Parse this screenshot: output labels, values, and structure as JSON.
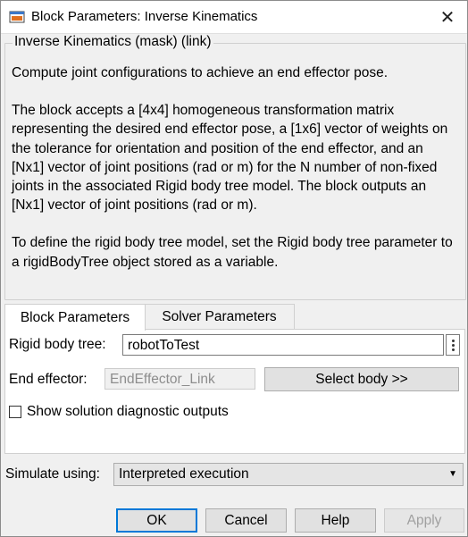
{
  "window": {
    "title": "Block Parameters: Inverse Kinematics",
    "close_icon": "close-icon",
    "app_icon": "matlab-icon"
  },
  "mask": {
    "legend": "Inverse Kinematics (mask) (link)",
    "paragraphs": [
      "Compute joint configurations to achieve an end effector pose.",
      "The block accepts a [4x4] homogeneous transformation matrix representing the desired end effector pose, a [1x6] vector of weights on the tolerance for orientation and position of the end effector, and an [Nx1] vector of joint positions (rad or m) for the N number of non-fixed joints in the associated Rigid body tree model. The block outputs an [Nx1] vector of joint positions (rad or m).",
      "To define the rigid body tree model, set the Rigid body tree parameter to a rigidBodyTree object stored as a variable."
    ]
  },
  "tabs": [
    {
      "label": "Block Parameters",
      "active": true
    },
    {
      "label": "Solver Parameters",
      "active": false
    }
  ],
  "block_params": {
    "rigid_body_tree_label": "Rigid body tree:",
    "rigid_body_tree_value": "robotToTest",
    "end_effector_label": "End effector:",
    "end_effector_value": "EndEffector_Link",
    "select_body_label": "Select body >>",
    "show_diag_label": "Show solution diagnostic outputs",
    "show_diag_checked": false
  },
  "simulate": {
    "label": "Simulate using:",
    "value": "Interpreted execution"
  },
  "buttons": {
    "ok": "OK",
    "cancel": "Cancel",
    "help": "Help",
    "apply": "Apply"
  },
  "colors": {
    "default_button_border": "#0078d7",
    "disabled_text": "#a0a0a0"
  }
}
